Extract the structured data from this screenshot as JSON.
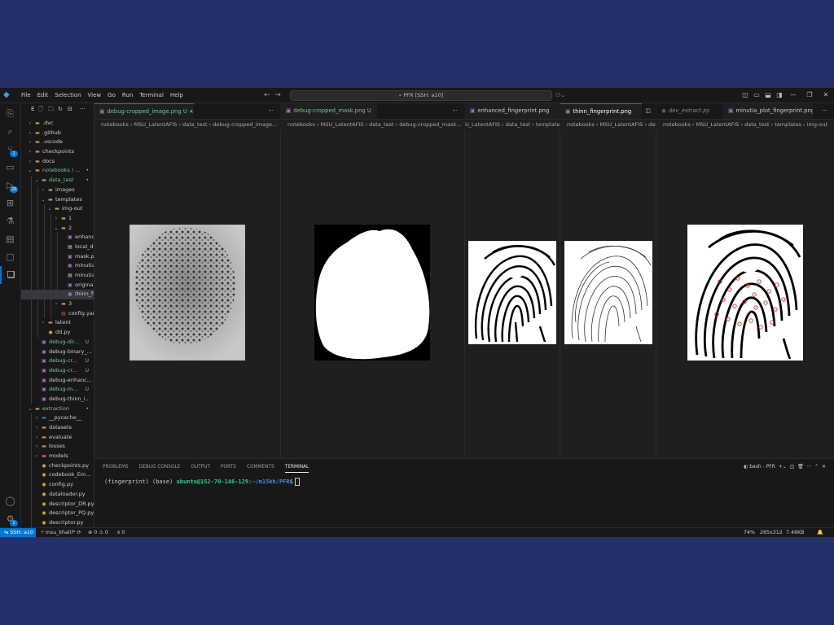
{
  "menu": [
    "File",
    "Edit",
    "Selection",
    "View",
    "Go",
    "Run",
    "Terminal",
    "Help"
  ],
  "command_center": "PFR [SSH: a10]",
  "activity_badges": {
    "source_control": "1",
    "run_debug": "20",
    "accounts": "1"
  },
  "sidebar": {
    "toolbar_letter": "E",
    "items": [
      {
        "label": ".dvc",
        "depth": 0,
        "type": "folder",
        "state": "collapsed"
      },
      {
        "label": ".github",
        "depth": 0,
        "type": "folder",
        "state": "collapsed"
      },
      {
        "label": ".vscode",
        "depth": 0,
        "type": "folder",
        "state": "collapsed"
      },
      {
        "label": "checkpoints",
        "depth": 0,
        "type": "folder",
        "state": "collapsed"
      },
      {
        "label": "docs",
        "depth": 0,
        "type": "folder",
        "state": "collapsed"
      },
      {
        "label": "notebooks / ...",
        "depth": 0,
        "type": "folder",
        "state": "expanded",
        "status": "•",
        "color": "#73c991"
      },
      {
        "label": "data_test",
        "depth": 1,
        "type": "folder",
        "state": "expanded",
        "status": "•",
        "color": "#73c991"
      },
      {
        "label": "images",
        "depth": 2,
        "type": "folder",
        "state": "collapsed"
      },
      {
        "label": "templates",
        "depth": 2,
        "type": "folder",
        "state": "expanded"
      },
      {
        "label": "img-out",
        "depth": 3,
        "type": "folder",
        "state": "expanded"
      },
      {
        "label": "1",
        "depth": 4,
        "type": "folder",
        "state": "collapsed"
      },
      {
        "label": "2",
        "depth": 4,
        "type": "folder",
        "state": "expanded"
      },
      {
        "label": "enhanced_...",
        "depth": 5,
        "type": "image"
      },
      {
        "label": "local_descr...",
        "depth": 5,
        "type": "file"
      },
      {
        "label": "mask.png",
        "depth": 5,
        "type": "image"
      },
      {
        "label": "minutia_pl...",
        "depth": 5,
        "type": "image"
      },
      {
        "label": "minutia_p...",
        "depth": 5,
        "type": "file"
      },
      {
        "label": "original.png",
        "depth": 5,
        "type": "image"
      },
      {
        "label": "thinn_fing...",
        "depth": 5,
        "type": "image",
        "selected": true
      },
      {
        "label": "3",
        "depth": 4,
        "type": "folder",
        "state": "collapsed"
      },
      {
        "label": "config.yaml",
        "depth": 4,
        "type": "yaml"
      },
      {
        "label": "latent",
        "depth": 2,
        "type": "folder",
        "state": "collapsed"
      },
      {
        "label": "dd.py",
        "depth": 2,
        "type": "python"
      },
      {
        "label": "debug-dir...",
        "depth": 1,
        "type": "image",
        "status": "U",
        "color": "#73c991"
      },
      {
        "label": "debug-binary_...",
        "depth": 1,
        "type": "image"
      },
      {
        "label": "debug-cr...",
        "depth": 1,
        "type": "image",
        "status": "U",
        "color": "#73c991"
      },
      {
        "label": "debug-cr...",
        "depth": 1,
        "type": "image",
        "status": "U",
        "color": "#73c991"
      },
      {
        "label": "debug-enhanc...",
        "depth": 1,
        "type": "image"
      },
      {
        "label": "debug-m...",
        "depth": 1,
        "type": "image",
        "status": "U",
        "color": "#73c991"
      },
      {
        "label": "debug-thinn_i...",
        "depth": 1,
        "type": "image"
      },
      {
        "label": "extraction",
        "depth": 0,
        "type": "folder",
        "state": "expanded",
        "status": "•",
        "color": "#73c991"
      },
      {
        "label": "__pycache__",
        "depth": 1,
        "type": "folder",
        "state": "collapsed"
      },
      {
        "label": "datasets",
        "depth": 1,
        "type": "folder",
        "state": "collapsed"
      },
      {
        "label": "evaluate",
        "depth": 1,
        "type": "folder",
        "state": "collapsed"
      },
      {
        "label": "losses",
        "depth": 1,
        "type": "folder",
        "state": "collapsed"
      },
      {
        "label": "models",
        "depth": 1,
        "type": "folder",
        "state": "collapsed"
      },
      {
        "label": "checkpoints.py",
        "depth": 1,
        "type": "python"
      },
      {
        "label": "codebook_Em...",
        "depth": 1,
        "type": "python"
      },
      {
        "label": "config.py",
        "depth": 1,
        "type": "python"
      },
      {
        "label": "dataloader.py",
        "depth": 1,
        "type": "python"
      },
      {
        "label": "descriptor_DR.py",
        "depth": 1,
        "type": "python"
      },
      {
        "label": "descriptor_PQ.py",
        "depth": 1,
        "type": "python"
      },
      {
        "label": "descriptor.py",
        "depth": 1,
        "type": "python"
      }
    ]
  },
  "groups": [
    {
      "tab": "debug-cropped_image.png",
      "status": "U",
      "close": "×",
      "more": "···",
      "crumbs": "notebooks › MSU_LatentAFIS › data_test › debug-cropped_image..."
    },
    {
      "tab": "debug-cropped_mask.png",
      "status": "U",
      "close": "",
      "more": "···",
      "crumbs": "notebooks › MSU_LatentAFIS › data_test › debug-cropped_mask..."
    },
    {
      "tab": "enhanced_fingerprint.png",
      "status": "",
      "close": "",
      "more": "",
      "crumbs": "U_LatentAFIS › data_test › templates"
    },
    {
      "tab": "thinn_fingerprint.png",
      "status": "",
      "close": "",
      "more": "",
      "crumbs": "notebooks › MSU_LatentAFIS › dat"
    },
    {
      "tab": "dev_extract.py",
      "tab2": "minutia_plot_fingerprint.png",
      "status": "",
      "close": "",
      "more": "···",
      "crumbs": "notebooks › MSU_LatentAFIS › data_test › templates › img-out"
    }
  ],
  "panel": {
    "tabs": [
      "PROBLEMS",
      "DEBUG CONSOLE",
      "OUTPUT",
      "PORTS",
      "COMMENTS",
      "TERMINAL"
    ],
    "active_tab": "TERMINAL",
    "shell": "bash - PFR",
    "prompt_env": "(fingerprint) (base)",
    "prompt_user": "ubuntu@152-70-146-129",
    "prompt_sep": ":",
    "prompt_path": "~/m15kh/PFR",
    "prompt_end": "$"
  },
  "status": {
    "remote": "SSH: a10",
    "branch": "msu_khalil*",
    "problems": "⊗ 0 ⚠ 0",
    "ports": "ʬ 0",
    "zoom": "74%",
    "dims": "265x312",
    "size": "7.46KB"
  },
  "colors": {
    "accent": "#0078d4",
    "git_untracked": "#73c991",
    "terminal_user": "#23d18b",
    "terminal_path": "#3b8eea"
  }
}
